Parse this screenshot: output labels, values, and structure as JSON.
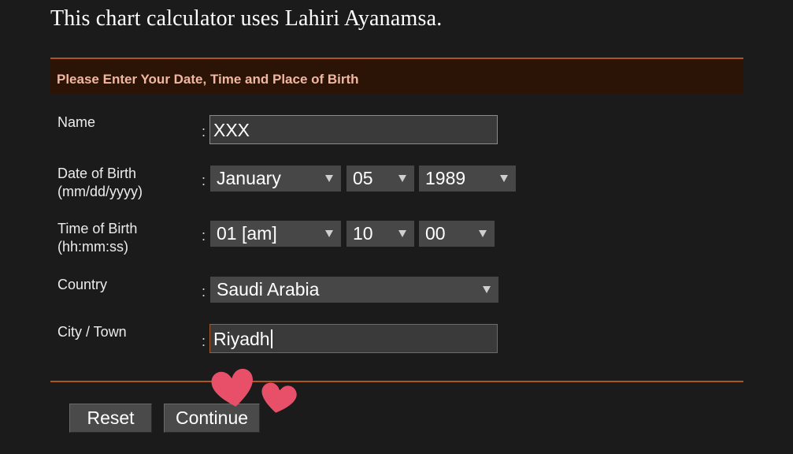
{
  "intro_text": "This chart calculator uses Lahiri Ayanamsa.",
  "form": {
    "header": "Please Enter Your Date, Time and Place of Birth",
    "colon": ":",
    "name": {
      "label": "Name",
      "value": "XXX"
    },
    "dob": {
      "label_line1": "Date of Birth",
      "label_line2": "(mm/dd/yyyy)",
      "month": "January",
      "day": "05",
      "year": "1989"
    },
    "tob": {
      "label_line1": "Time of Birth",
      "label_line2": "(hh:mm:ss)",
      "hour": "01 [am]",
      "minute": "10",
      "second": "00"
    },
    "country": {
      "label": "Country",
      "value": "Saudi Arabia"
    },
    "city": {
      "label": "City / Town",
      "value": "Riyadh"
    }
  },
  "buttons": {
    "reset": "Reset",
    "continue": "Continue"
  },
  "colors": {
    "accent_border": "#b0561d",
    "header_bg": "#2b1406",
    "header_text": "#f2b7a0",
    "heart_sticker": "#e8506a"
  },
  "decorations": {
    "sticker_icon": "heart-sticker-icon"
  }
}
